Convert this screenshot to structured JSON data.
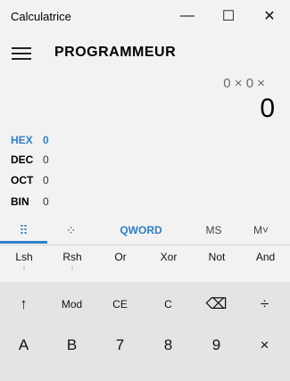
{
  "window": {
    "title": "Calculatrice",
    "controls": {
      "minimize": "—",
      "maximize": "☐",
      "close": "✕"
    }
  },
  "header": {
    "mode": "PROGRAMMEUR"
  },
  "display": {
    "expression": "0 × 0 ×",
    "result": "0"
  },
  "radix": [
    {
      "label": "HEX",
      "value": "0",
      "active": true
    },
    {
      "label": "DEC",
      "value": "0",
      "active": false
    },
    {
      "label": "OCT",
      "value": "0",
      "active": false
    },
    {
      "label": "BIN",
      "value": "0",
      "active": false
    }
  ],
  "toolbar": {
    "keypad_icon": "⠿",
    "bits_icon": "⁘",
    "word_size": "QWORD",
    "memory_store": "MS",
    "memory_recall": "M˅"
  },
  "bitwise": [
    {
      "label": "Lsh",
      "sub": "↑"
    },
    {
      "label": "Rsh",
      "sub": "↑"
    },
    {
      "label": "Or",
      "sub": ""
    },
    {
      "label": "Xor",
      "sub": ""
    },
    {
      "label": "Not",
      "sub": ""
    },
    {
      "label": "And",
      "sub": ""
    }
  ],
  "keys": {
    "row1": [
      "↑",
      "Mod",
      "CE",
      "C",
      "⌫",
      "÷"
    ],
    "row2": [
      "A",
      "B",
      "7",
      "8",
      "9",
      "×"
    ]
  },
  "colors": {
    "accent": "#2f7fc8",
    "background": "#f2f2f2",
    "keypad": "#e4e4e4"
  }
}
